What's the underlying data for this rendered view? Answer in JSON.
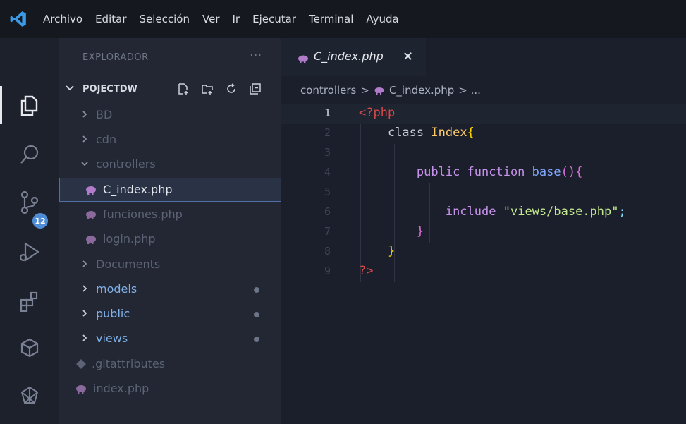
{
  "menu": [
    "Archivo",
    "Editar",
    "Selección",
    "Ver",
    "Ir",
    "Ejecutar",
    "Terminal",
    "Ayuda"
  ],
  "activity": {
    "icons": [
      "explorer-icon",
      "search-icon",
      "source-control-icon",
      "run-debug-icon",
      "extensions-icon",
      "remote-icon",
      "docker-icon"
    ],
    "badge": "12"
  },
  "sidebar": {
    "title": "EXPLORADOR",
    "more": "···",
    "folder": "POJECTDW",
    "items": [
      {
        "label": "BD",
        "type": "folder",
        "open": false
      },
      {
        "label": "cdn",
        "type": "folder",
        "open": false
      },
      {
        "label": "controllers",
        "type": "folder",
        "open": true
      },
      {
        "label": "C_index.php",
        "type": "php",
        "selected": true
      },
      {
        "label": "funciones.php",
        "type": "php"
      },
      {
        "label": "login.php",
        "type": "php"
      },
      {
        "label": "Documents",
        "type": "folder",
        "open": false
      },
      {
        "label": "models",
        "type": "folder",
        "open": false,
        "modified": true
      },
      {
        "label": "public",
        "type": "folder",
        "open": false,
        "modified": true
      },
      {
        "label": "views",
        "type": "folder",
        "open": false,
        "modified": true
      },
      {
        "label": ".gitattributes",
        "type": "git"
      },
      {
        "label": "index.php",
        "type": "php"
      }
    ]
  },
  "editor": {
    "tab": "C_index.php",
    "close": "✕",
    "breadcrumb": [
      "controllers",
      ">",
      "C_index.php",
      "> ..."
    ],
    "line_numbers": [
      "1",
      "2",
      "3",
      "4",
      "5",
      "6",
      "7",
      "8",
      "9"
    ],
    "code": {
      "l1": "<?php",
      "l2_kw": "class",
      "l2_name": "Index",
      "l2_brace": "{",
      "l4_kw": "public function",
      "l4_fn": "base",
      "l4_paren": "()",
      "l4_brace": "{",
      "l6_kw": "include",
      "l6_str": "\"views/base.php\"",
      "l6_semi": ";",
      "l7": "}",
      "l8": "}",
      "l9": "?>"
    }
  },
  "colors": {
    "php_icon": "#b07bc9",
    "selected_border": "#4f6fa6",
    "badge": "#4f8cd6"
  }
}
